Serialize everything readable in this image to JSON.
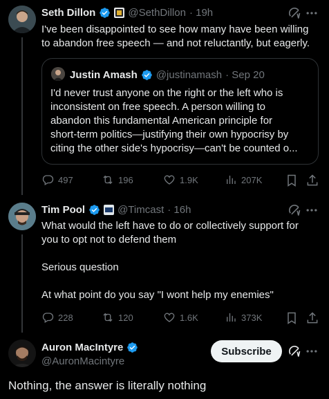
{
  "tweets": [
    {
      "name": "Seth Dillon",
      "handle": "@SethDillon",
      "time": "· 19h",
      "text_lines": [
        "I've been disappointed to see how many have been willing",
        "to abandon free speech — and not reluctantly, but eagerly."
      ],
      "quote": {
        "name": "Justin Amash",
        "handle": "@justinamash",
        "time": "· Sep 20",
        "text_lines": [
          "I'd never trust anyone on the right or the left who is",
          "inconsistent on free speech. A person willing to",
          "abandon this fundamental American principle for",
          "short-term politics—justifying their own hypocrisy by",
          "citing the other side's hypocrisy—can't be counted o..."
        ]
      },
      "stats": {
        "replies": "497",
        "reposts": "196",
        "likes": "1.9K",
        "views": "207K"
      }
    },
    {
      "name": "Tim Pool",
      "handle": "@Timcast",
      "time": "· 16h",
      "text_lines": [
        "What would the left have to do or collectively support for",
        "you to opt not to defend them",
        "",
        "Serious question",
        "",
        "At what point do you say \"I wont help my enemies\""
      ],
      "stats": {
        "replies": "228",
        "reposts": "120",
        "likes": "1.6K",
        "views": "373K"
      }
    },
    {
      "name": "Auron MacIntyre",
      "handle": "@AuronMacintyre",
      "subscribe_label": "Subscribe",
      "text": "Nothing, the answer is literally nothing"
    }
  ],
  "colors": {
    "accent": "#1d9bf0",
    "muted": "#71767b",
    "text": "#e7e9ea",
    "border": "#2f3336"
  },
  "icons": [
    "grok-icon",
    "more-icon",
    "reply-icon",
    "repost-icon",
    "like-icon",
    "views-icon",
    "bookmark-icon",
    "share-icon",
    "verified-badge-icon"
  ]
}
